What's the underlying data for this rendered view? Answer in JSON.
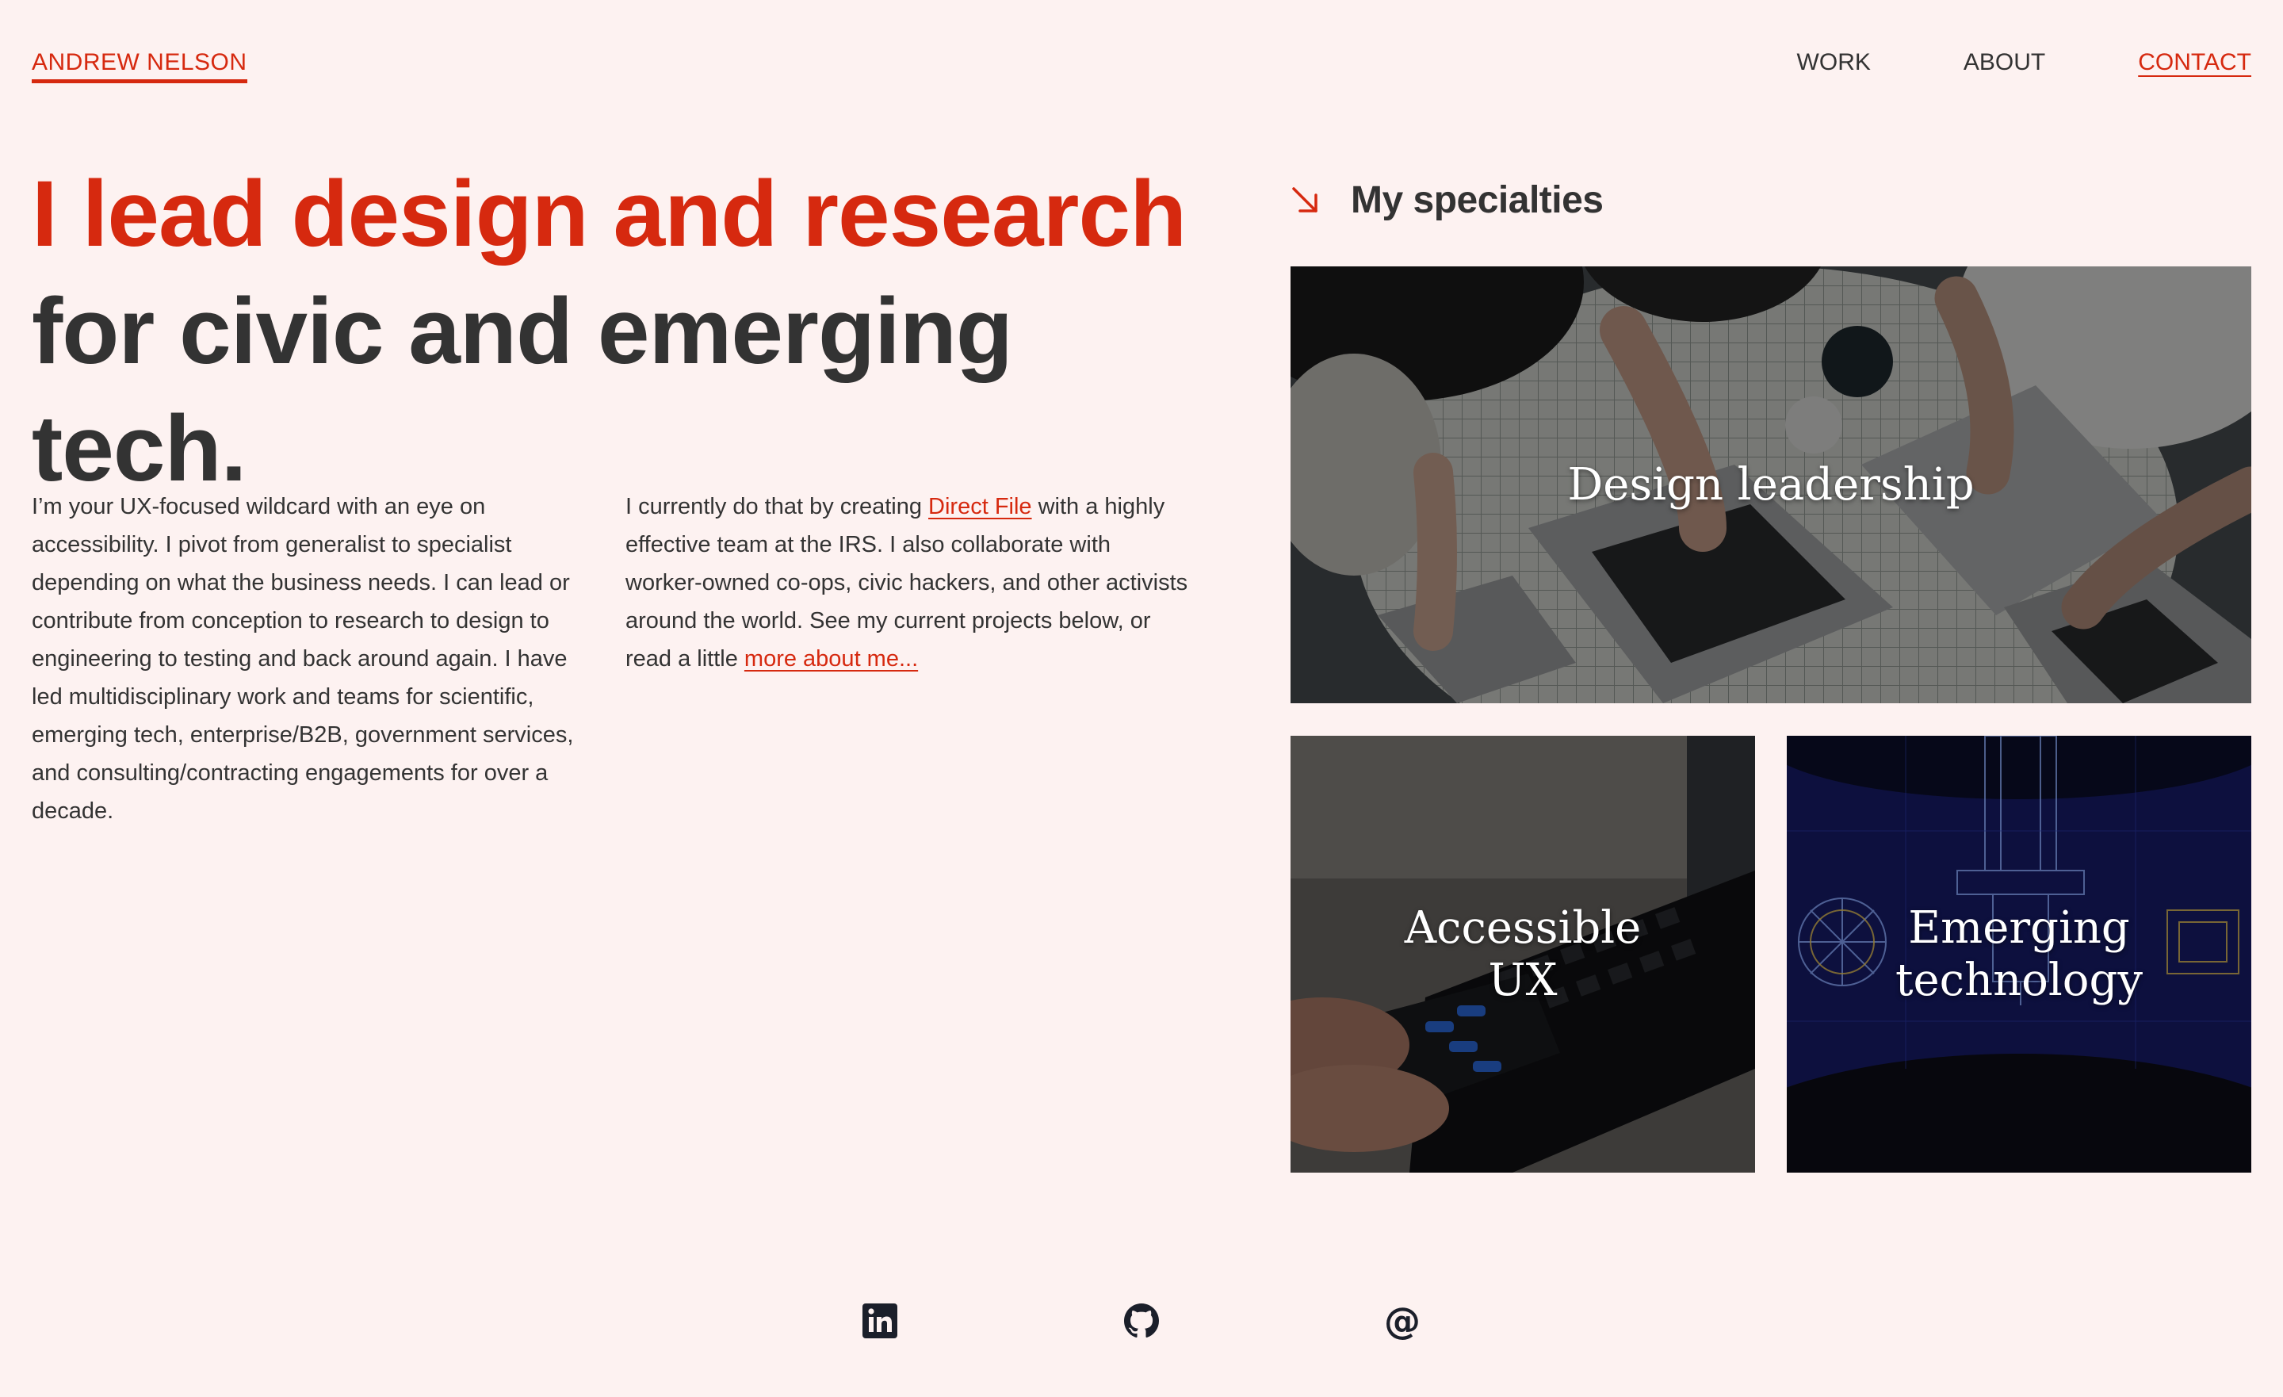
{
  "header": {
    "logo": "ANDREW NELSON",
    "nav": {
      "work": "WORK",
      "about": "ABOUT",
      "contact": "CONTACT"
    }
  },
  "hero": {
    "line1": "I lead design and research",
    "line2": "for civic and emerging tech."
  },
  "intro": {
    "col1": "I’m your UX-focused wildcard with an eye on accessibility. I pivot from generalist to specialist depending on what the business needs. I can lead or contribute from conception to research to design to engineering to testing and back around again. I have led multidisciplinary work and teams for scientific, emerging tech, enterprise/B2B, government services, and consulting/contracting engagements for over a decade.",
    "col2_part1": "I currently do that by creating ",
    "col2_link1": "Direct File",
    "col2_part2": " with a highly effective team at the IRS. I also collaborate with worker-owned co-ops, civic hackers, and other activists around the world. See my current projects below, or read a little ",
    "col2_link2": "more about me..."
  },
  "specialties": {
    "title": "My specialties",
    "cards": [
      {
        "label_line1": "Design leadership",
        "label_line2": ""
      },
      {
        "label_line1": "Accessible",
        "label_line2": "UX"
      },
      {
        "label_line1": "Emerging",
        "label_line2": "technology"
      }
    ]
  },
  "icons": {
    "specialties_arrow": "arrow-down-right-icon",
    "linkedin": "linkedin-icon",
    "github": "github-icon",
    "email": "at-sign-icon",
    "email_glyph": "@"
  },
  "colors": {
    "accent": "#d6290f",
    "text": "#333333",
    "background": "#fdf2f1"
  }
}
